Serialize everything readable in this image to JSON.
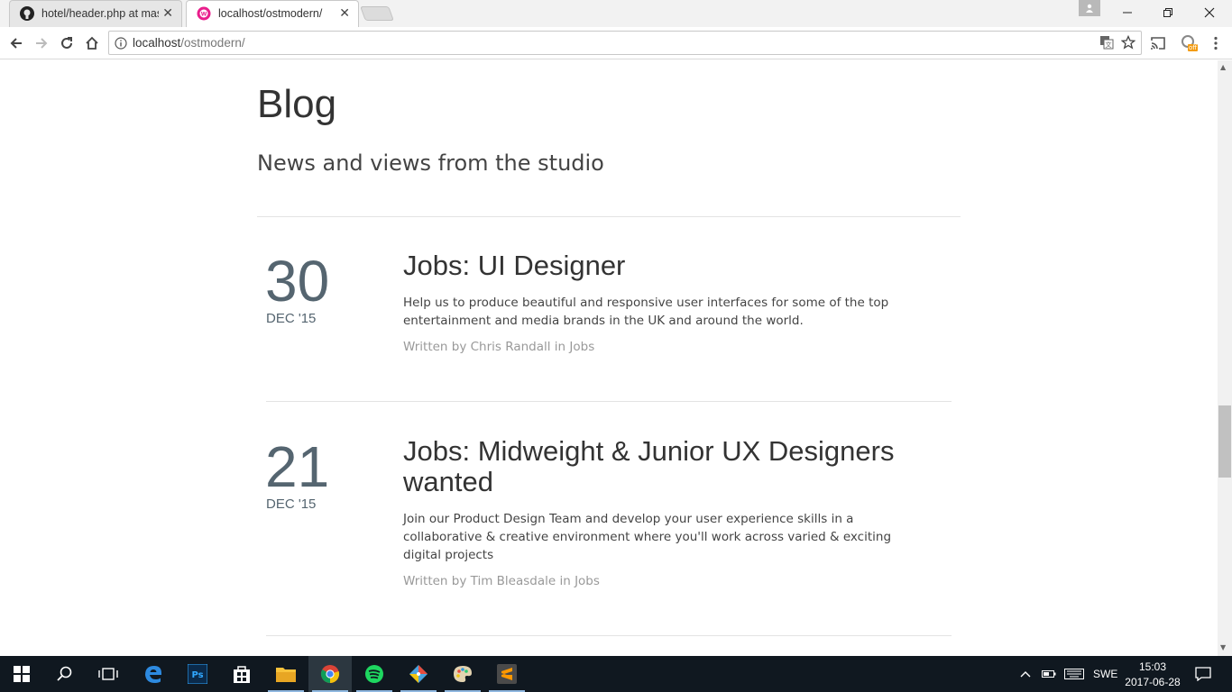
{
  "browser": {
    "tabs": [
      {
        "title": "hotel/header.php at mas",
        "favicon": "github-icon"
      },
      {
        "title": "localhost/ostmodern/",
        "favicon": "wamp-icon"
      }
    ],
    "address": {
      "host": "localhost",
      "path": "/ostmodern/"
    }
  },
  "page": {
    "title": "Blog",
    "subtitle": "News and views from the studio",
    "posts": [
      {
        "day": "30",
        "month": "DEC '15",
        "title": "Jobs: UI Designer",
        "excerpt": "Help us to produce beautiful and responsive user interfaces for some of the top entertainment and media brands in the UK and around the world.",
        "meta": "Written by Chris Randall in Jobs"
      },
      {
        "day": "21",
        "month": "DEC '15",
        "title": "Jobs: Midweight & Junior UX Designers wanted",
        "excerpt": "Join our Product Design Team and develop your user experience skills in a collaborative & creative environment where you'll work across varied & exciting digital projects",
        "meta": "Written by Tim Bleasdale in Jobs"
      }
    ]
  },
  "taskbar": {
    "language": "SWE",
    "time": "15:03",
    "date": "2017-06-28",
    "apps": [
      "windows-start-icon",
      "search-icon",
      "task-view-icon",
      "edge-icon",
      "photoshop-icon",
      "store-icon",
      "file-explorer-icon",
      "chrome-icon",
      "spotify-icon",
      "git-icon",
      "paint-icon",
      "sublime-icon"
    ]
  },
  "extension_badge": "off",
  "colors": {
    "date": "#556570",
    "meta": "#999999",
    "taskbar": "#101820"
  }
}
